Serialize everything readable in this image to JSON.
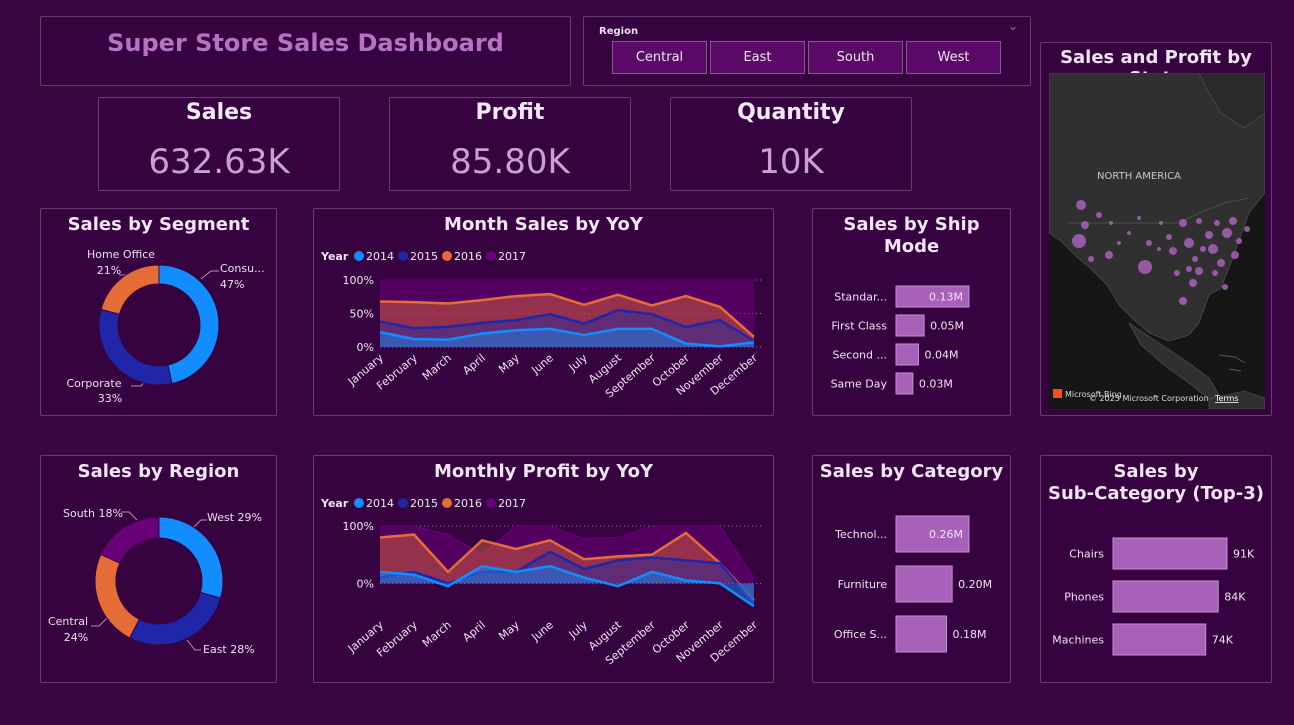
{
  "header": {
    "title": "Super Store Sales Dashboard"
  },
  "slicer": {
    "label": "Region",
    "options": [
      "Central",
      "East",
      "South",
      "West"
    ]
  },
  "kpis": {
    "sales": {
      "label": "Sales",
      "value": "632.63K"
    },
    "profit": {
      "label": "Profit",
      "value": "85.80K"
    },
    "quantity": {
      "label": "Quantity",
      "value": "10K"
    }
  },
  "segment": {
    "title": "Sales by Segment",
    "chart_data": {
      "type": "pie",
      "slices": [
        {
          "label": "Consu...",
          "value": 47,
          "pct": "47%",
          "color": "#118dff"
        },
        {
          "label": "Corporate",
          "value": 33,
          "pct": "33%",
          "color": "#1f27a8"
        },
        {
          "label": "Home Office",
          "value": 21,
          "pct": "21%",
          "color": "#e66c37"
        }
      ]
    }
  },
  "month_sales": {
    "title": "Month Sales by YoY",
    "chart_data": {
      "type": "area",
      "legend_title": "Year",
      "x": [
        "January",
        "February",
        "March",
        "April",
        "May",
        "June",
        "July",
        "August",
        "September",
        "October",
        "November",
        "December"
      ],
      "y_ticks": [
        "100%",
        "50%",
        "0%"
      ],
      "ylim": [
        0,
        100
      ],
      "series": [
        {
          "name": "2017",
          "color": "#6b007b",
          "values": [
            100,
            100,
            100,
            100,
            100,
            100,
            100,
            100,
            100,
            100,
            100,
            100
          ]
        },
        {
          "name": "2016",
          "color": "#e66c37",
          "values": [
            68,
            67,
            65,
            70,
            76,
            79,
            63,
            78,
            62,
            76,
            60,
            15
          ]
        },
        {
          "name": "2015",
          "color": "#1f27a8",
          "values": [
            38,
            28,
            30,
            36,
            40,
            49,
            35,
            55,
            49,
            30,
            40,
            9
          ]
        },
        {
          "name": "2014",
          "color": "#118dff",
          "values": [
            22,
            12,
            11,
            20,
            25,
            27,
            18,
            27,
            27,
            5,
            1,
            7
          ]
        }
      ]
    }
  },
  "ship_mode": {
    "title_line1": "Sales by Ship",
    "title_line2": "Mode",
    "chart_data": {
      "type": "bar",
      "categories": [
        "Standar...",
        "First Class",
        "Second ...",
        "Same Day"
      ],
      "values": [
        0.13,
        0.05,
        0.04,
        0.03
      ],
      "labels": [
        "0.13M",
        "0.05M",
        "0.04M",
        "0.03M"
      ],
      "color": "#a861b9"
    }
  },
  "map": {
    "title": "Sales and Profit by State",
    "continent_label": "NORTH AMERICA",
    "attribution": "© 2025 Microsoft Corporation",
    "terms": "Terms",
    "provider": "Microsoft Bing"
  },
  "region": {
    "title": "Sales by Region",
    "chart_data": {
      "type": "pie",
      "slices": [
        {
          "label": "West 29%",
          "value": 29,
          "color": "#118dff"
        },
        {
          "label": "East 28%",
          "value": 28,
          "color": "#1f27a8"
        },
        {
          "label": "Central 24%",
          "value": 24,
          "color": "#e66c37"
        },
        {
          "label": "South 18%",
          "value": 18,
          "color": "#6b007b"
        }
      ]
    }
  },
  "monthly_profit": {
    "title": "Monthly Profit by YoY",
    "chart_data": {
      "type": "area",
      "legend_title": "Year",
      "x": [
        "January",
        "February",
        "March",
        "April",
        "May",
        "June",
        "July",
        "August",
        "September",
        "October",
        "November",
        "December"
      ],
      "y_ticks": [
        "100%",
        "0%"
      ],
      "ylim": [
        -50,
        100
      ],
      "series": [
        {
          "name": "2017",
          "color": "#6b007b",
          "values": [
            100,
            100,
            85,
            50,
            100,
            100,
            78,
            80,
            100,
            100,
            100,
            10
          ]
        },
        {
          "name": "2016",
          "color": "#e66c37",
          "values": [
            80,
            85,
            20,
            75,
            60,
            75,
            42,
            47,
            50,
            88,
            35,
            -30
          ]
        },
        {
          "name": "2015",
          "color": "#1f27a8",
          "values": [
            10,
            20,
            0,
            20,
            20,
            55,
            25,
            40,
            45,
            40,
            35,
            -35
          ]
        },
        {
          "name": "2014",
          "color": "#118dff",
          "values": [
            20,
            15,
            -5,
            30,
            20,
            30,
            10,
            -5,
            20,
            5,
            0,
            -40
          ]
        }
      ]
    }
  },
  "category": {
    "title": "Sales by Category",
    "chart_data": {
      "type": "bar",
      "categories": [
        "Technol...",
        "Furniture",
        "Office S..."
      ],
      "values": [
        0.26,
        0.2,
        0.18
      ],
      "labels": [
        "0.26M",
        "0.20M",
        "0.18M"
      ],
      "color": "#a861b9"
    }
  },
  "subcategory": {
    "title_line1": "Sales by",
    "title_line2": "Sub-Category (Top-3)",
    "chart_data": {
      "type": "bar",
      "categories": [
        "Chairs",
        "Phones",
        "Machines"
      ],
      "values": [
        91,
        84,
        74
      ],
      "labels": [
        "91K",
        "84K",
        "74K"
      ],
      "color": "#a861b9"
    }
  }
}
